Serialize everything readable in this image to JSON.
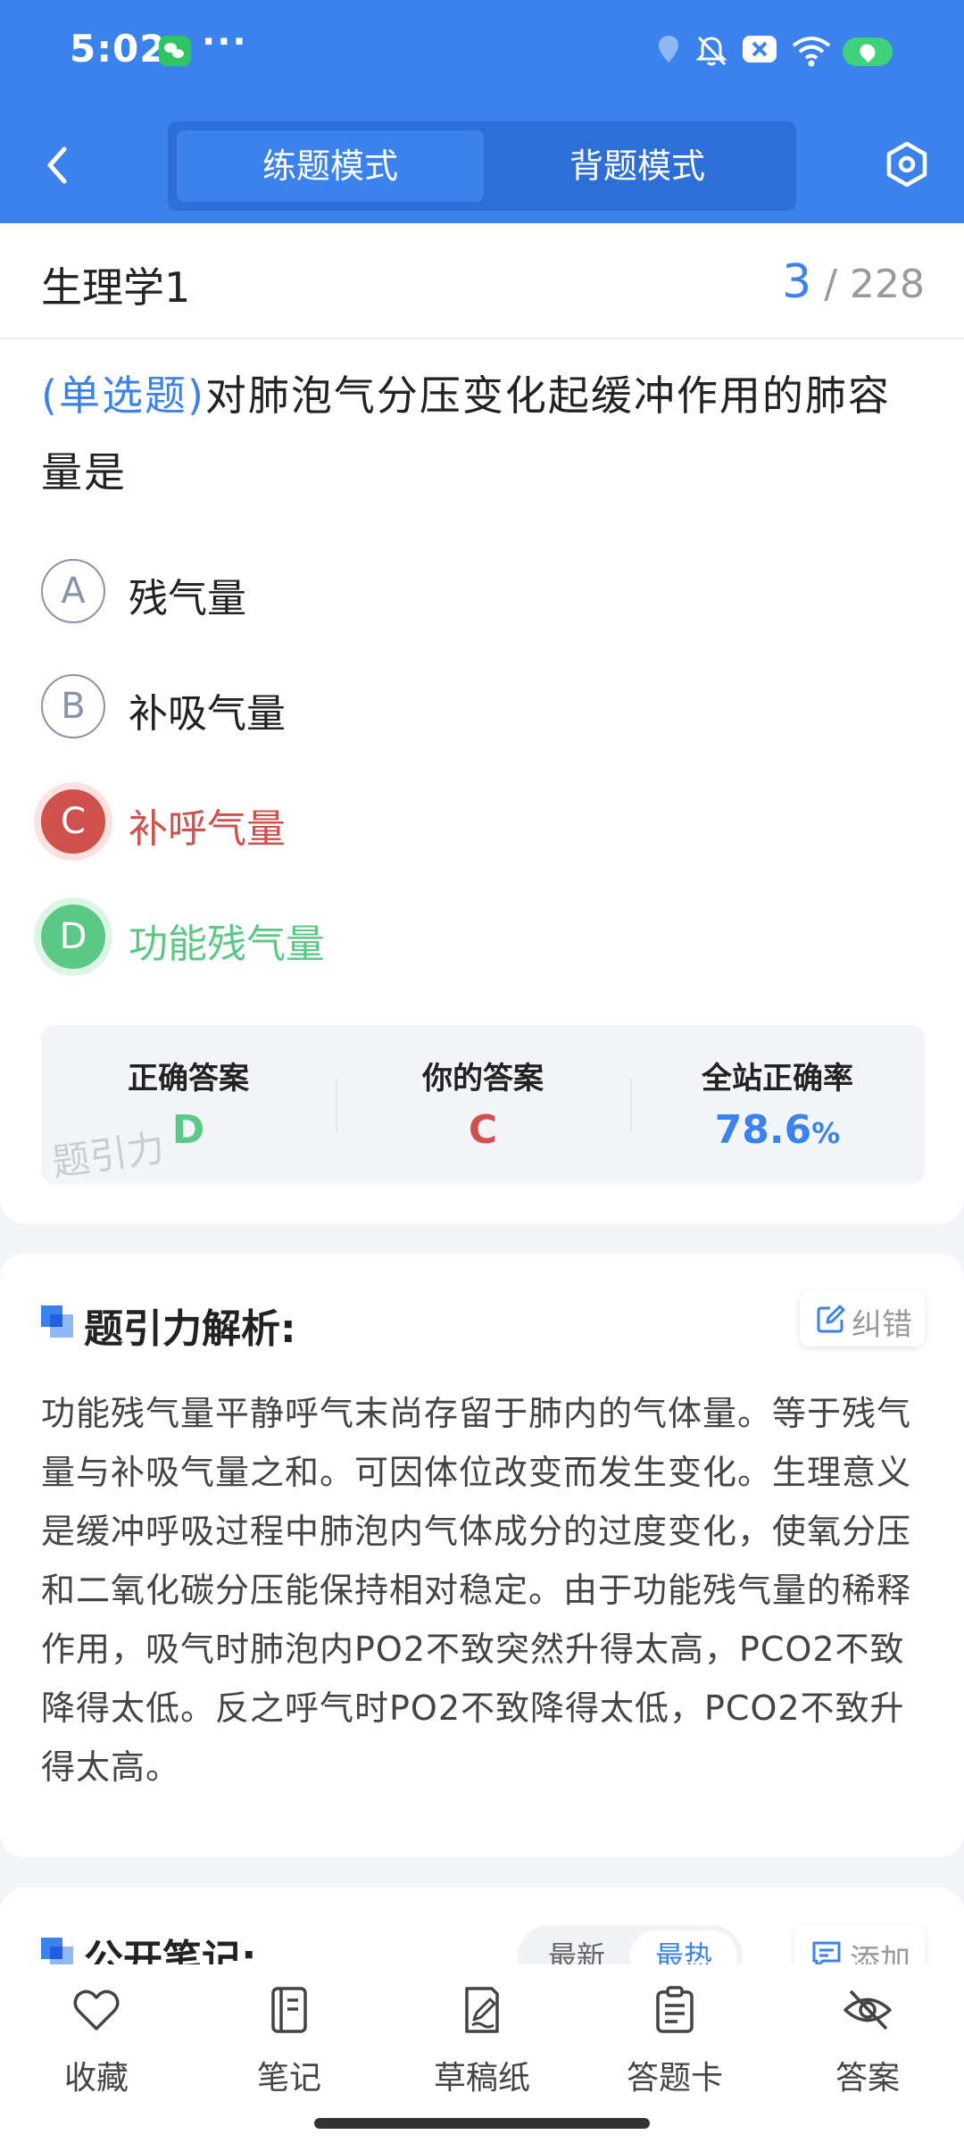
{
  "status_bar": {
    "time": "5:02",
    "more": "···"
  },
  "header": {
    "mode_practice": "练题模式",
    "mode_recite": "背题模式"
  },
  "question_card": {
    "subject": "生理学1",
    "progress_current": "3",
    "progress_total": "228",
    "question_type": "(单选题)",
    "question_text": "对肺泡气分压变化起缓冲作用的肺容量是",
    "options": [
      {
        "letter": "A",
        "text": "残气量",
        "state": "normal"
      },
      {
        "letter": "B",
        "text": "补吸气量",
        "state": "normal"
      },
      {
        "letter": "C",
        "text": "补呼气量",
        "state": "wrong"
      },
      {
        "letter": "D",
        "text": "功能残气量",
        "state": "correct"
      }
    ],
    "stats": {
      "correct_label": "正确答案",
      "correct_value": "D",
      "yours_label": "你的答案",
      "yours_value": "C",
      "rate_label": "全站正确率",
      "rate_value": "78.6",
      "rate_unit": "%"
    },
    "watermark": "题引力"
  },
  "analysis": {
    "title": "题引力解析:",
    "correct_button": "纠错",
    "text": "功能残气量平静呼气末尚存留于肺内的气体量。等于残气量与补吸气量之和。可因体位改变而发生变化。生理意义是缓冲呼吸过程中肺泡内气体成分的过度变化，使氧分压和二氧化碳分压能保持相对稳定。由于功能残气量的稀释作用，吸气时肺泡内PO2不致突然升得太高，PCO2不致降得太低。反之呼气时PO2不致降得太低，PCO2不致升得太高。"
  },
  "notes": {
    "title": "公开笔记:",
    "sort_latest": "最新",
    "sort_hot": "最热",
    "add_button": "添加"
  },
  "bottom_bar": [
    {
      "label": "收藏",
      "icon": "heart-icon"
    },
    {
      "label": "笔记",
      "icon": "notebook-icon"
    },
    {
      "label": "草稿纸",
      "icon": "draft-icon"
    },
    {
      "label": "答题卡",
      "icon": "answer-sheet-icon"
    },
    {
      "label": "答案",
      "icon": "eye-off-icon"
    }
  ],
  "colors": {
    "primary": "#3b82ec",
    "wrong": "#d0504d",
    "correct": "#5cc886"
  }
}
